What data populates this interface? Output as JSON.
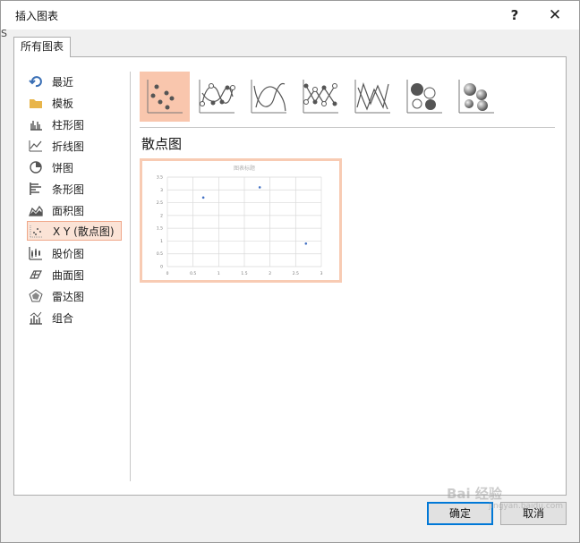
{
  "dialog": {
    "title": "插入图表",
    "help_label": "?",
    "close_label": "✕",
    "behind_text": "S",
    "tab_label": "所有图表",
    "ok_label": "确定",
    "cancel_label": "取消"
  },
  "sidebar": {
    "items": [
      {
        "label": "最近",
        "icon": "recent-icon"
      },
      {
        "label": "模板",
        "icon": "folder-icon"
      },
      {
        "label": "柱形图",
        "icon": "column-chart-icon"
      },
      {
        "label": "折线图",
        "icon": "line-chart-icon"
      },
      {
        "label": "饼图",
        "icon": "pie-chart-icon"
      },
      {
        "label": "条形图",
        "icon": "bar-chart-icon"
      },
      {
        "label": "面积图",
        "icon": "area-chart-icon"
      },
      {
        "label": "X Y (散点图)",
        "icon": "scatter-chart-icon",
        "selected": true
      },
      {
        "label": "股价图",
        "icon": "stock-chart-icon"
      },
      {
        "label": "曲面图",
        "icon": "surface-chart-icon"
      },
      {
        "label": "雷达图",
        "icon": "radar-chart-icon"
      },
      {
        "label": "组合",
        "icon": "combo-chart-icon"
      }
    ]
  },
  "gallery": {
    "subtypes": [
      {
        "icon": "scatter-markers-icon",
        "selected": true
      },
      {
        "icon": "scatter-smooth-lines-markers-icon"
      },
      {
        "icon": "scatter-smooth-lines-icon"
      },
      {
        "icon": "scatter-straight-lines-markers-icon"
      },
      {
        "icon": "scatter-straight-lines-icon"
      },
      {
        "icon": "bubble-icon"
      },
      {
        "icon": "bubble-3d-icon"
      }
    ],
    "selected_title": "散点图"
  },
  "preview": {
    "chart_data": {
      "type": "scatter",
      "title": "图表标题",
      "x": [
        0.7,
        1.8,
        2.7
      ],
      "y": [
        2.7,
        3.1,
        0.9
      ],
      "xlim": [
        0,
        3
      ],
      "ylim": [
        0,
        3.5
      ],
      "x_ticks": [
        "0",
        "0.5",
        "1",
        "1.5",
        "2",
        "2.5",
        "3"
      ],
      "y_ticks": [
        "0",
        "0.5",
        "1",
        "1.5",
        "2",
        "2.5",
        "3",
        "3.5"
      ],
      "grid": true,
      "marker_color": "#4472c4"
    }
  },
  "watermark": {
    "text": "Bai 经验",
    "sub": "jingyan.baidu.com"
  },
  "colors": {
    "accent": "#0078d7",
    "selection_fill": "#f9c6ad",
    "selection_border": "#f0a88a",
    "preview_border": "#f8cbb3",
    "icon_gray": "#555555"
  }
}
